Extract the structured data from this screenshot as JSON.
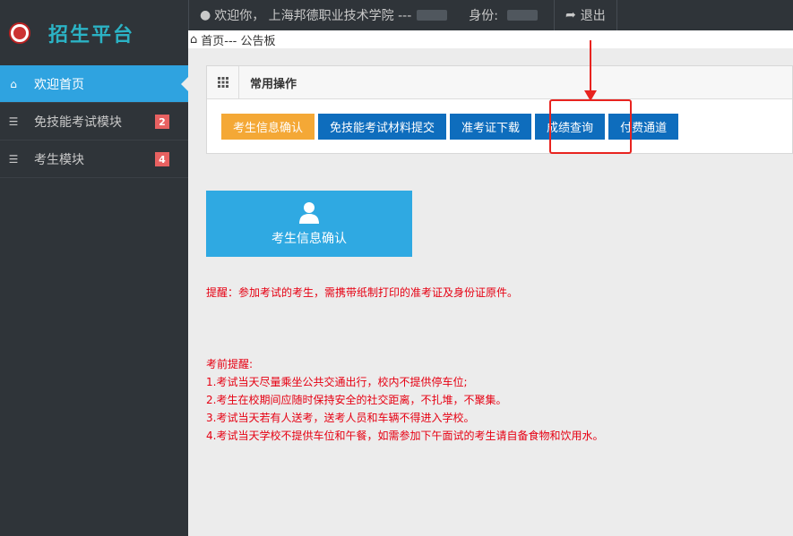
{
  "sidebar": {
    "brand": "招生平台",
    "items": [
      {
        "label": "欢迎首页",
        "badge": ""
      },
      {
        "label": "免技能考试模块",
        "badge": "2"
      },
      {
        "label": "考生模块",
        "badge": "4"
      }
    ]
  },
  "topbar": {
    "welcome": "欢迎你， 上海邦德职业技术学院 ---",
    "identity_label": "身份:",
    "logout": "退出"
  },
  "breadcrumb": "首页--- 公告板",
  "panel": {
    "title": "常用操作",
    "buttons": [
      "考生信息确认",
      "免技能考试材料提交",
      "准考证下载",
      "成绩查询",
      "付费通道"
    ]
  },
  "tile": {
    "label": "考生信息确认"
  },
  "reminder": "提醒：参加考试的考生，需携带纸制打印的准考证及身份证原件。",
  "exam_notes": {
    "title": "考前提醒:",
    "lines": [
      "1.考试当天尽量乘坐公共交通出行，校内不提供停车位;",
      "2.考生在校期间应随时保持安全的社交距离，不扎堆，不聚集。",
      "3.考试当天若有人送考，送考人员和车辆不得进入学校。",
      "4.考试当天学校不提供车位和午餐，如需参加下午面试的考生请自备食物和饮用水。"
    ]
  },
  "colors": {
    "accent": "#2fa3e0",
    "brand": "#2bb3c5",
    "highlight": "#e8231f",
    "notice": "#e60012"
  }
}
